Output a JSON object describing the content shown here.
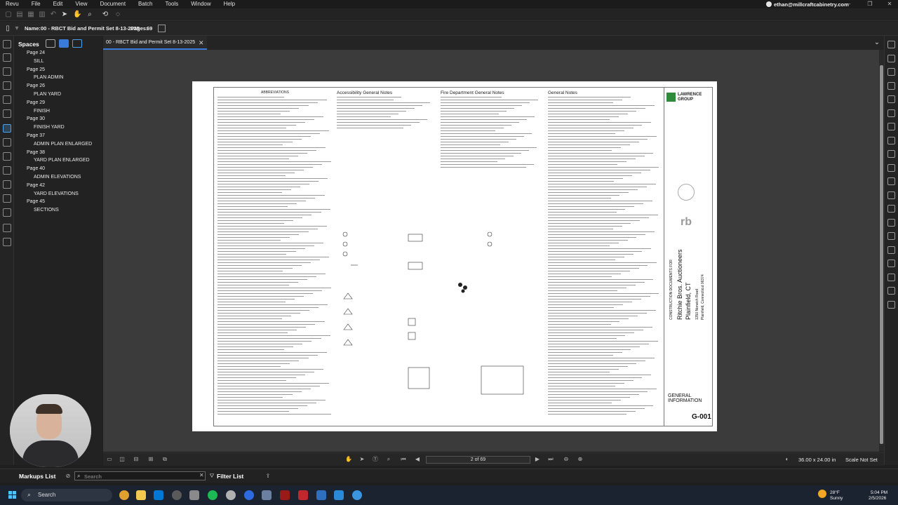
{
  "menu": {
    "items": [
      "Revu",
      "File",
      "Edit",
      "View",
      "Document",
      "Batch",
      "Tools",
      "Window",
      "Help"
    ],
    "account": "ethan@millcraftcabinetry.com"
  },
  "info": {
    "name_label": "Name:",
    "name_value": "00 - RBCT Bid and Permit Set 8-13-2025",
    "pages_label": "Pages:",
    "pages_value": "69"
  },
  "spaces": {
    "title": "Spaces",
    "items": [
      {
        "label": "Page 24",
        "level": 0
      },
      {
        "label": "SILL",
        "level": 1
      },
      {
        "label": "Page 25",
        "level": 0
      },
      {
        "label": "PLAN ADMIN",
        "level": 1
      },
      {
        "label": "Page 26",
        "level": 0
      },
      {
        "label": "PLAN YARD",
        "level": 1
      },
      {
        "label": "Page 29",
        "level": 0
      },
      {
        "label": "FINISH",
        "level": 1
      },
      {
        "label": "Page 30",
        "level": 0
      },
      {
        "label": "FINISH YARD",
        "level": 1
      },
      {
        "label": "Page 37",
        "level": 0
      },
      {
        "label": "ADMIN PLAN ENLARGED",
        "level": 1
      },
      {
        "label": "Page 38",
        "level": 0
      },
      {
        "label": "YARD PLAN ENLARGED",
        "level": 1
      },
      {
        "label": "Page 40",
        "level": 0
      },
      {
        "label": "ADMIN ELEVATIONS",
        "level": 1
      },
      {
        "label": "Page 42",
        "level": 0
      },
      {
        "label": "YARD ELEVATIONS",
        "level": 1
      },
      {
        "label": "Page 45",
        "level": 0
      },
      {
        "label": "SECTIONS",
        "level": 1
      }
    ]
  },
  "tab": {
    "label": "00 - RBCT Bid and Permit Set 8-13-2025",
    "close": "✕"
  },
  "sheet": {
    "abbreviations_title": "ABBREVIATIONS",
    "accessibility_title": "Accessibility General Notes",
    "fire_title": "Fire Department General Notes",
    "general_title": "General Notes",
    "logo_line1": "LAWRENCE",
    "logo_line2": "GROUP",
    "project_label": "CONSTRUCTION DOCUMENTS FOR",
    "project_name": "Ritchie Bros. Auctioneers",
    "project_city": "Plainfield, CT",
    "project_address1": "1350 Norwich Road",
    "project_address2": "Plainfield, Connecticut 06374",
    "sheet_title_line1": "GENERAL",
    "sheet_title_line2": "INFORMATION",
    "sheet_number": "G-001"
  },
  "nav": {
    "page_indicator": "2 of 69",
    "dimensions": "36.00 x 24.00 in",
    "scale": "Scale Not Set"
  },
  "markups": {
    "title": "Markups List",
    "search_placeholder": "Search",
    "filter_label": "Filter List"
  },
  "taskbar": {
    "search_label": "Search",
    "weather_temp": "28°F",
    "weather_cond": "Sunny",
    "time": "5:04 PM",
    "date": "2/5/2026"
  },
  "colors": {
    "accent": "#3b7bd8",
    "brand_green": "#2f8a3c",
    "active_icon": "#4aa3f0"
  }
}
